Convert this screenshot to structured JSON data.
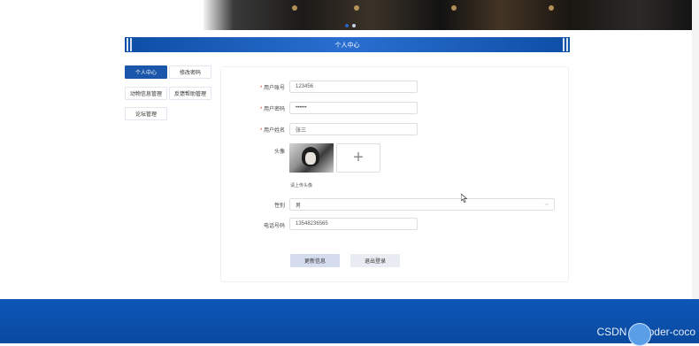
{
  "header": {
    "title": "个人中心",
    "carousel_dots": [
      true,
      false
    ]
  },
  "sidebar": {
    "items": [
      {
        "label": "个人中心",
        "active": true
      },
      {
        "label": "修改密码",
        "active": false
      },
      {
        "label": "动物信息管理",
        "active": false
      },
      {
        "label": "反馈帮助管理",
        "active": false
      },
      {
        "label": "论坛管理",
        "active": false
      }
    ]
  },
  "form": {
    "account_label": "用户账号",
    "account_value": "123456",
    "password_label": "用户密码",
    "password_value": "••••••",
    "name_label": "用户姓名",
    "name_value": "张三",
    "avatar_label": "头像",
    "upload_plus": "+",
    "upload_hint": "请上传头像",
    "gender_label": "性别",
    "gender_value": "男",
    "phone_label": "电话号码",
    "phone_value": "13548236565",
    "required_mark": "*"
  },
  "actions": {
    "update_label": "更新信息",
    "logout_label": "退出登录"
  },
  "footer": {
    "watermark": "CSDN @Coder-coco"
  },
  "colors": {
    "primary": "#1a57ab",
    "footer": "#0c57b8"
  }
}
